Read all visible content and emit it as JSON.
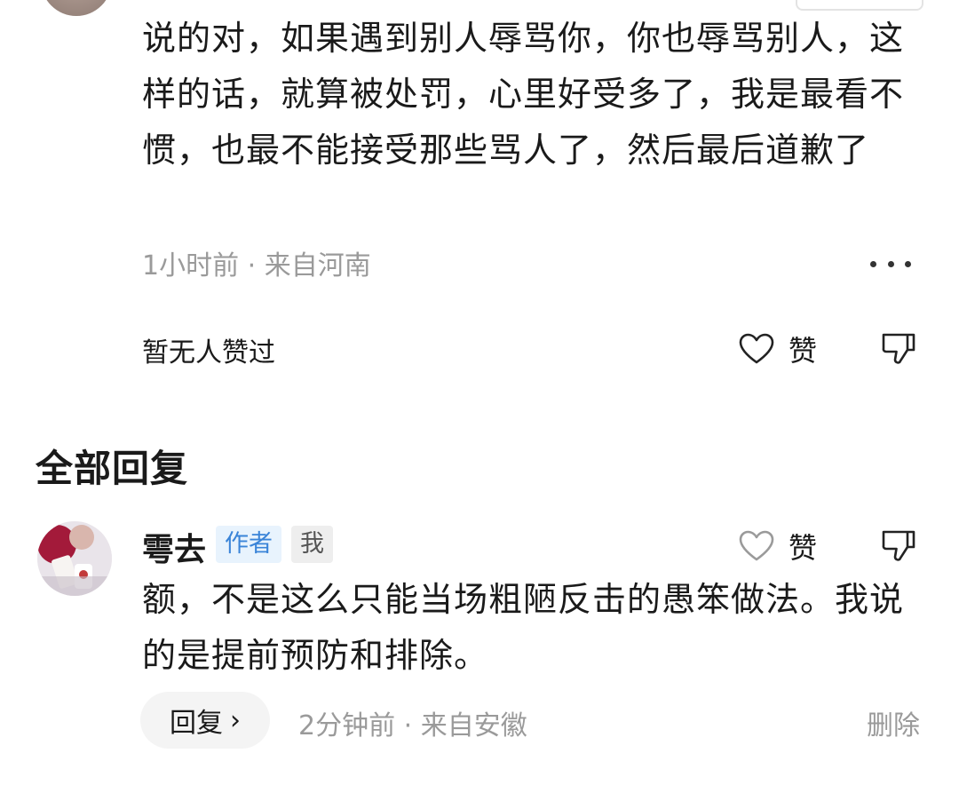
{
  "parent_comment": {
    "text": "说的对，如果遇到别人辱骂你，你也辱骂别人，这样的话，就算被处罚，心里好受多了，我是最看不惯，也最不能接受那些骂人了，然后最后道歉了",
    "meta": "1小时前 · 来自河南",
    "no_likes_text": "暂无人赞过",
    "like_label": "赞"
  },
  "section_title": "全部回复",
  "reply": {
    "username": "雩去",
    "tag_author": "作者",
    "tag_me": "我",
    "like_label": "赞",
    "text": "额，不是这么只能当场粗陋反击的愚笨做法。我说的是提前预防和排除。",
    "reply_button_label": "回复",
    "meta": "2分钟前 · 来自安徽",
    "delete_label": "删除"
  },
  "icons": {
    "more": "more-dots-icon",
    "like": "heart-outline-icon",
    "dislike": "thumbs-down-icon",
    "chevron": "chevron-right-icon"
  }
}
